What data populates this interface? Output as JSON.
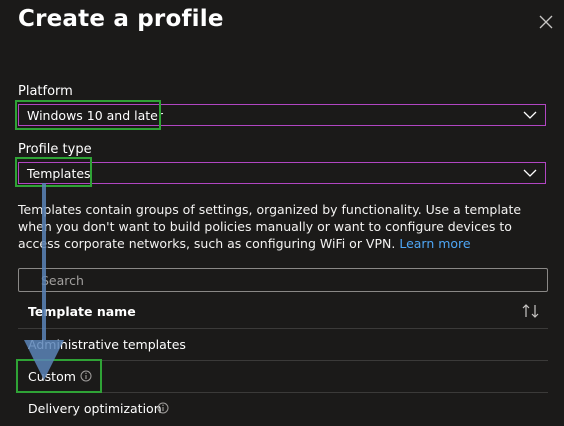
{
  "header": {
    "title": "Create a profile"
  },
  "platform": {
    "label": "Platform",
    "value": "Windows 10 and later"
  },
  "profile_type": {
    "label": "Profile type",
    "value": "Templates"
  },
  "description": {
    "text": "Templates contain groups of settings, organized by functionality. Use a template when you don't want to build policies manually or want to configure devices to access corporate networks, such as configuring WiFi or VPN.",
    "link": "Learn more"
  },
  "search": {
    "placeholder": "Search",
    "value": ""
  },
  "table": {
    "column_header": "Template name",
    "rows": [
      {
        "label": "Administrative templates"
      },
      {
        "label": "Custom"
      },
      {
        "label": "Delivery optimization"
      }
    ]
  },
  "colors": {
    "accent_border": "#b146c2",
    "highlight": "#2fa336",
    "link": "#4ea6f5",
    "arrow": "#5b84b8"
  }
}
